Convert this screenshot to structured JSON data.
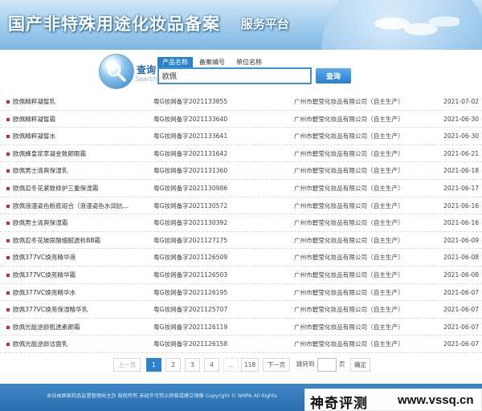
{
  "banner": {
    "title": "国产非特殊用途化妆品备案",
    "subtitle": "服务平台"
  },
  "search": {
    "logo_cn": "查询",
    "logo_en": "Search",
    "tabs": [
      {
        "label": "产品名称",
        "active": true
      },
      {
        "label": "备案编号",
        "active": false
      },
      {
        "label": "单位名称",
        "active": false
      }
    ],
    "query": "欧佩",
    "button_label": "查询"
  },
  "results": [
    {
      "name": "欧佩精粹凝皙乳",
      "reg": "粤G妆网备字2021133855",
      "company": "广州市碧莹化妆品有限公司（自主生产）",
      "date": "2021-07-02"
    },
    {
      "name": "欧佩精粹凝皙霜",
      "reg": "粤G妆网备字2021133640",
      "company": "广州市碧莹化妆品有限公司（自主生产）",
      "date": "2021-06-30"
    },
    {
      "name": "欧佩精粹凝皙水",
      "reg": "粤G妆网备字2021133641",
      "company": "广州市碧莹化妆品有限公司（自主生产）",
      "date": "2021-06-30"
    },
    {
      "name": "欧佩蜂皇浆萃凝金致颜眼霜",
      "reg": "粤G妆网备字2021131642",
      "company": "广州市碧莹化妆品有限公司（自主生产）",
      "date": "2021-06-21"
    },
    {
      "name": "欧佩男士清爽保湿乳",
      "reg": "粤G妆网备字2021131360",
      "company": "广州市碧莹化妆品有限公司（自主生产）",
      "date": "2021-06-18"
    },
    {
      "name": "欧佩忍冬花紧致修护三重保湿霜",
      "reg": "粤G妆网备字2021130986",
      "company": "广州市碧莹化妆品有限公司（自主生产）",
      "date": "2021-06-17"
    },
    {
      "name": "欧佩浪漫姿色粉底组合（浪漫姿色水润抗…",
      "reg": "粤G妆网备字2021130572",
      "company": "广州市碧莹化妆品有限公司（自主生产）",
      "date": "2021-06-16"
    },
    {
      "name": "欧佩男士清爽保湿霜",
      "reg": "粤G妆网备字2021130392",
      "company": "广州市碧莹化妆品有限公司（自主生产）",
      "date": "2021-06-16"
    },
    {
      "name": "欧佩忍冬花玻尿酸细腻透析BB霜",
      "reg": "粤G妆网备字2021127175",
      "company": "广州市碧莹化妆品有限公司（自主生产）",
      "date": "2021-06-09"
    },
    {
      "name": "欧佩377VC焕亮精华液",
      "reg": "粤G妆网备字2021126509",
      "company": "广州市碧莹化妆品有限公司（自主生产）",
      "date": "2021-06-08"
    },
    {
      "name": "欧佩377VC焕亮精华霜",
      "reg": "粤G妆网备字2021126503",
      "company": "广州市碧莹化妆品有限公司（自主生产）",
      "date": "2021-06-08"
    },
    {
      "name": "欧佩377VC焕亮精华水",
      "reg": "粤G妆网备字2021126195",
      "company": "广州市碧莹化妆品有限公司（自主生产）",
      "date": "2021-06-07"
    },
    {
      "name": "欧佩377VC焕亮保湿精华乳",
      "reg": "粤G妆网备字2021125707",
      "company": "广州市碧莹化妆品有限公司（自主生产）",
      "date": "2021-06-07"
    },
    {
      "name": "欧佩光能逆龄肌透素颜霜",
      "reg": "粤G妆网备字2021126119",
      "company": "广州市碧莹化妆品有限公司（自主生产）",
      "date": "2021-06-07"
    },
    {
      "name": "欧佩光能逆龄洁面乳",
      "reg": "粤G妆网备字2021126158",
      "company": "广州市碧莹化妆品有限公司（自主生产）",
      "date": "2021-06-07"
    }
  ],
  "pagination": {
    "prev": "上一页",
    "pages": [
      "1",
      "2",
      "3",
      "4"
    ],
    "current_page": "1",
    "ellipsis": "...",
    "last_page": "118",
    "next": "下一页",
    "jump_label": "跳转到",
    "jump_unit": "页",
    "confirm": "确定"
  },
  "footer": {
    "text": "本站由国家药品监督管理局主办 版权所有 未经许可禁止转载或建立镜像 Copyright © NMPA All Rights"
  },
  "watermark": {
    "cn": "神奇评测",
    "en": "www.vssq.cn"
  }
}
